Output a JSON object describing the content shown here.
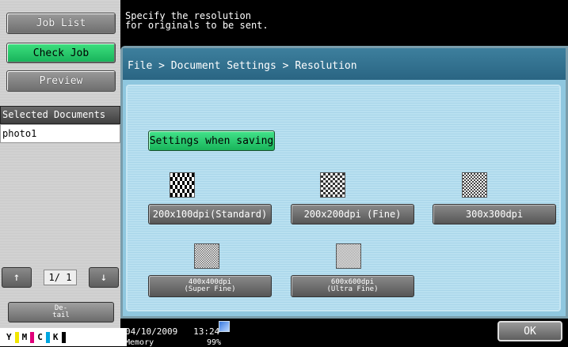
{
  "sidebar": {
    "job_list": "Job List",
    "check_job": "Check Job",
    "preview": "Preview",
    "selected_documents_header": "Selected Documents",
    "selected_documents": [
      "photo1"
    ],
    "page_indicator": "1/ 1",
    "detail_line1": "De-",
    "detail_line2": "tail",
    "toner": [
      {
        "label": "Y",
        "color": "#f2e600"
      },
      {
        "label": "M",
        "color": "#e0007a"
      },
      {
        "label": "C",
        "color": "#00a6e0"
      },
      {
        "label": "K",
        "color": "#000000"
      }
    ]
  },
  "message": {
    "line1": "Specify the resolution",
    "line2": "for originals to be sent."
  },
  "breadcrumb": "File > Document Settings > Resolution",
  "settings_when_saving": "Settings when saving",
  "resolutions": {
    "standard": "200x100dpi(Standard)",
    "fine": "200x200dpi (Fine)",
    "r300": "300x300dpi",
    "superfine_line1": "400x400dpi",
    "superfine_line2": "(Super Fine)",
    "ultrafine_line1": "600x600dpi",
    "ultrafine_line2": "(Ultra Fine)"
  },
  "status": {
    "date": "04/10/2009",
    "time": "13:24",
    "memory_label": "Memory",
    "memory_value": "99%"
  },
  "ok": "OK"
}
